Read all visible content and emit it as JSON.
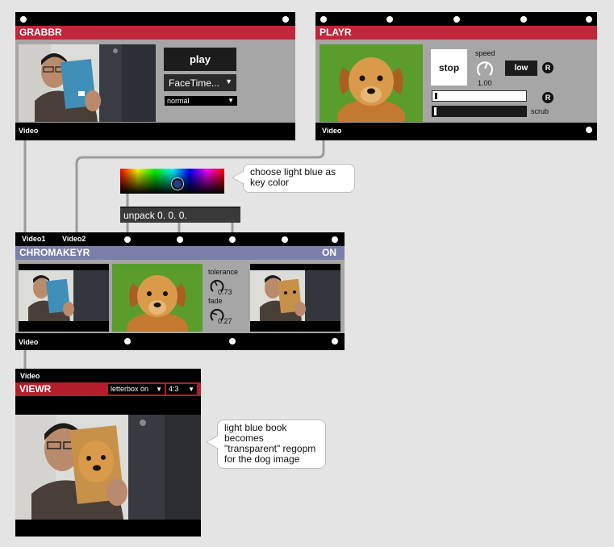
{
  "grabbr": {
    "title": "GRABBR",
    "play_label": "play",
    "device_value": "FaceTime...",
    "mode_value": "normal",
    "output_label": "Video"
  },
  "playr": {
    "title": "PLAYR",
    "stop_label": "stop",
    "speed_label": "speed",
    "speed_value": "1.00",
    "quality_label": "low",
    "r_label": "R",
    "scrub_label": "scrub",
    "output_label": "Video"
  },
  "color_note": "choose light blue as key color",
  "unpack_label": "unpack 0. 0. 0.",
  "chromakeyr": {
    "input1": "Video1",
    "input2": "Video2",
    "title": "CHROMAKEYR",
    "status": "ON",
    "tolerance_label": "tolerance",
    "tolerance_value": "0.73",
    "fade_label": "fade",
    "fade_value": "0.27",
    "output_label": "Video"
  },
  "viewr": {
    "input_label": "Video",
    "title": "VIEWR",
    "letterbox_value": "letterbox on",
    "aspect_value": "4:3"
  },
  "result_note": "light blue book becomes \"transparent\" regopm for the dog image",
  "colors": {
    "grabbr_red": "#c0273b",
    "chroma_purple": "#7a7fa9",
    "viewr_red": "#b31e2a",
    "panel_gray": "#a6a6a6",
    "key_blue": "#1e3f8a"
  }
}
